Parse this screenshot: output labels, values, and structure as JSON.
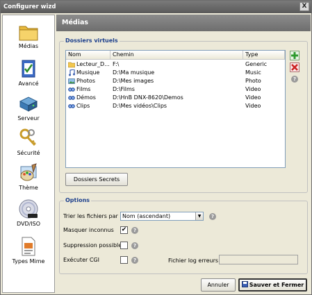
{
  "window": {
    "title": "Configurer wizd",
    "close_glyph": "X"
  },
  "sidebar": {
    "items": [
      {
        "label": "Médias",
        "icon": "folder-icon"
      },
      {
        "label": "Avancé",
        "icon": "checklist-icon"
      },
      {
        "label": "Serveur",
        "icon": "server-icon"
      },
      {
        "label": "Sécurité",
        "icon": "keys-icon"
      },
      {
        "label": "Thème",
        "icon": "palette-icon"
      },
      {
        "label": "DVD/ISO",
        "icon": "dvd-icon"
      },
      {
        "label": "Types Mime",
        "icon": "document-icon"
      }
    ]
  },
  "header": {
    "title": "Médias"
  },
  "virtual_folders": {
    "title": "Dossiers virtuels",
    "columns": [
      "Nom",
      "Chemin",
      "Type"
    ],
    "rows": [
      {
        "name": "Lecteur_D...",
        "path": "F:\\",
        "type": "Generic",
        "icon": "folder-icon"
      },
      {
        "name": "Musique",
        "path": "D:\\Ma musique",
        "type": "Music",
        "icon": "music-icon"
      },
      {
        "name": "Photos",
        "path": "D:\\Mes images",
        "type": "Photo",
        "icon": "photo-icon"
      },
      {
        "name": "Films",
        "path": "D:\\Films",
        "type": "Video",
        "icon": "film-icon"
      },
      {
        "name": "Démos",
        "path": "D:\\HnB DNX-8620\\Demos",
        "type": "Video",
        "icon": "film-icon"
      },
      {
        "name": "Clips",
        "path": "D:\\Mes vidéos\\Clips",
        "type": "Video",
        "icon": "film-icon"
      }
    ],
    "secret_button": "Dossiers Secrets",
    "help_glyph": "?"
  },
  "options": {
    "title": "Options",
    "sort_label": "Trier les fichiers par",
    "sort_value": "Nom (ascendant)",
    "hide_unknown_label": "Masquer inconnus",
    "hide_unknown_checked": true,
    "check_glyph": "✔",
    "delete_label": "Suppression possible",
    "delete_checked": false,
    "cgi_label": "Exécuter CGI",
    "cgi_checked": false,
    "log_label": "Fichier log erreurs",
    "log_value": "",
    "help_glyph": "?"
  },
  "footer": {
    "cancel": "Annuler",
    "save": "Sauver et Fermer"
  },
  "colors": {
    "accent_title": "#1c3f8c",
    "add": "#2e9a2e",
    "remove": "#cc2222"
  }
}
